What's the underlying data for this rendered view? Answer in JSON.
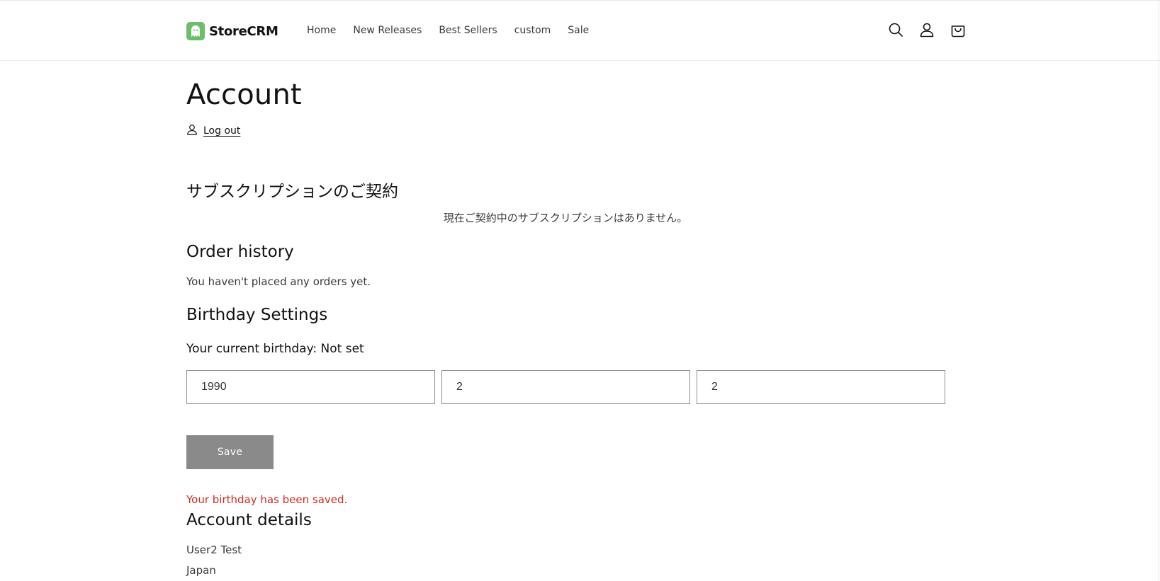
{
  "brand": {
    "name": "StoreCRM",
    "logo_color": "#6abf69"
  },
  "nav": {
    "items": [
      {
        "label": "Home"
      },
      {
        "label": "New Releases"
      },
      {
        "label": "Best Sellers"
      },
      {
        "label": "custom"
      },
      {
        "label": "Sale"
      }
    ]
  },
  "header_icons": [
    "search-icon",
    "account-icon",
    "cart-icon"
  ],
  "page": {
    "title": "Account",
    "logout_label": "Log out"
  },
  "subscriptions": {
    "title": "サブスクリプションのご契約",
    "empty_text": "現在ご契約中のサブスクリプションはありません。"
  },
  "orders": {
    "title": "Order history",
    "empty_text": "You haven't placed any orders yet."
  },
  "birthday": {
    "title": "Birthday Settings",
    "current_text": "Your current birthday: Not set",
    "year_value": "1990",
    "month_value": "2",
    "day_value": "2",
    "save_label": "Save",
    "saved_message": "Your birthday has been saved.",
    "saved_color": "#d62a1f"
  },
  "account_details": {
    "title": "Account details",
    "name": "User2 Test",
    "country": "Japan"
  }
}
